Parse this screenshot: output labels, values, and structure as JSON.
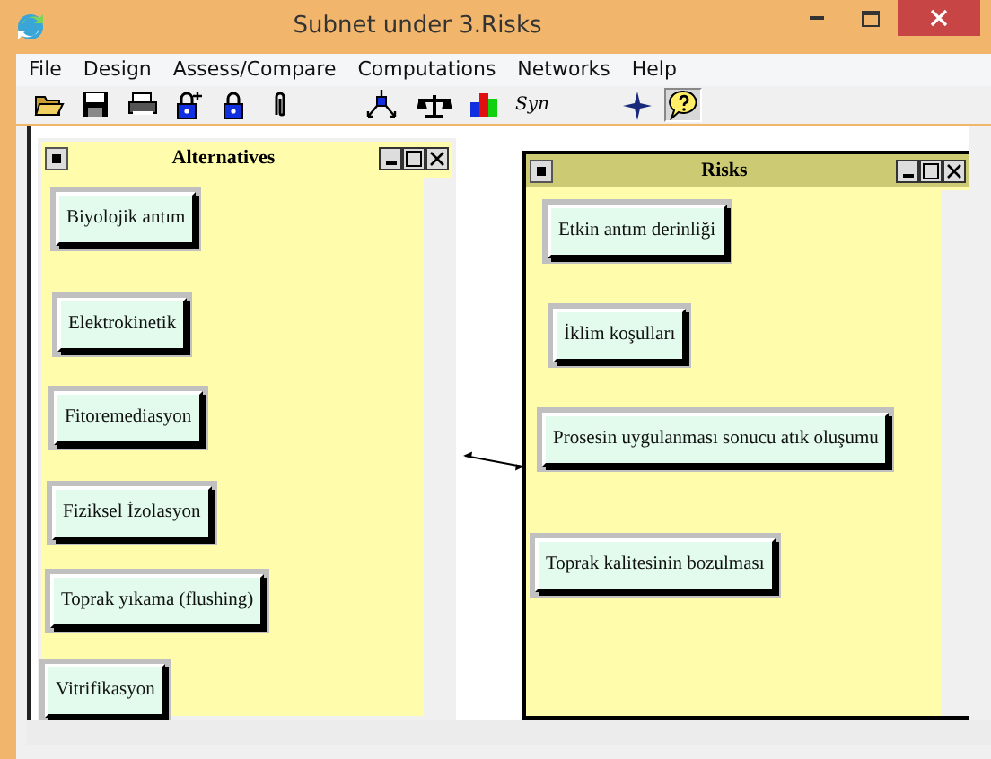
{
  "window": {
    "title": "Subnet under 3.Risks"
  },
  "menu": [
    "File",
    "Design",
    "Assess/Compare",
    "Computations",
    "Networks",
    "Help"
  ],
  "toolbar": [
    {
      "kind": "open",
      "pressed": false
    },
    {
      "kind": "save",
      "pressed": false
    },
    {
      "kind": "print",
      "pressed": false
    },
    {
      "kind": "lock-plus",
      "pressed": false
    },
    {
      "kind": "lock",
      "pressed": false
    },
    {
      "kind": "clip",
      "pressed": false
    },
    {
      "kind": "gap"
    },
    {
      "kind": "network",
      "pressed": false
    },
    {
      "kind": "balance",
      "pressed": false
    },
    {
      "kind": "bars",
      "pressed": false
    },
    {
      "kind": "text",
      "label": "Syn",
      "pressed": false
    },
    {
      "kind": "gap"
    },
    {
      "kind": "star",
      "pressed": false
    },
    {
      "kind": "help",
      "pressed": true
    }
  ],
  "clusters": [
    {
      "title": "Alternatives",
      "active": false,
      "nodes": [
        {
          "label": "Biyolojik antım"
        },
        {
          "label": "Elektrokinetik"
        },
        {
          "label": "Fitoremediasyon"
        },
        {
          "label": "Fiziksel İzolasyon"
        },
        {
          "label": "Toprak yıkama (flushing)"
        },
        {
          "label": "Vitrifikasyon"
        }
      ]
    },
    {
      "title": "Risks",
      "active": true,
      "nodes": [
        {
          "label": "Etkin antım derinliği"
        },
        {
          "label": "İklim koşulları"
        },
        {
          "label": "Prosesin uygulanması sonucu atık oluşumu"
        },
        {
          "label": "Toprak kalitesinin bozulması"
        }
      ]
    }
  ]
}
